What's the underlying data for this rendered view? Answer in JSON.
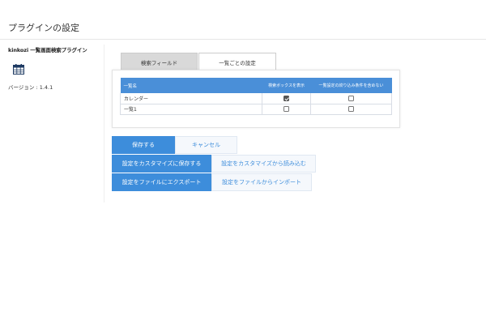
{
  "page": {
    "title": "プラグインの設定"
  },
  "sidebar": {
    "plugin_name": "kinkozi 一覧画面検索プラグイン",
    "icon": "calendar-grid-icon",
    "version": "バージョン : 1.4.1"
  },
  "tabs": [
    {
      "label": "検索フィールド",
      "active": false
    },
    {
      "label": "一覧ごとの設定",
      "active": true
    }
  ],
  "table": {
    "headers": [
      "一覧名",
      "検索ボックスを表示",
      "一覧設定の絞り込み条件を含めない"
    ],
    "rows": [
      {
        "name": "カレンダー",
        "show_search_box": true,
        "exclude_filter": false
      },
      {
        "name": "一覧1",
        "show_search_box": false,
        "exclude_filter": false
      }
    ]
  },
  "buttons": {
    "save": "保存する",
    "cancel": "キャンセル",
    "save_custom": "設定をカスタマイズに保存する",
    "load_custom": "設定をカスタマイズから読み込む",
    "export_file": "設定をファイルにエクスポート",
    "import_file": "設定をファイルからインポート"
  },
  "colors": {
    "accent": "#3d8ddb",
    "table_header": "#4a8fd8",
    "inactive_tab": "#d9d9d9"
  }
}
